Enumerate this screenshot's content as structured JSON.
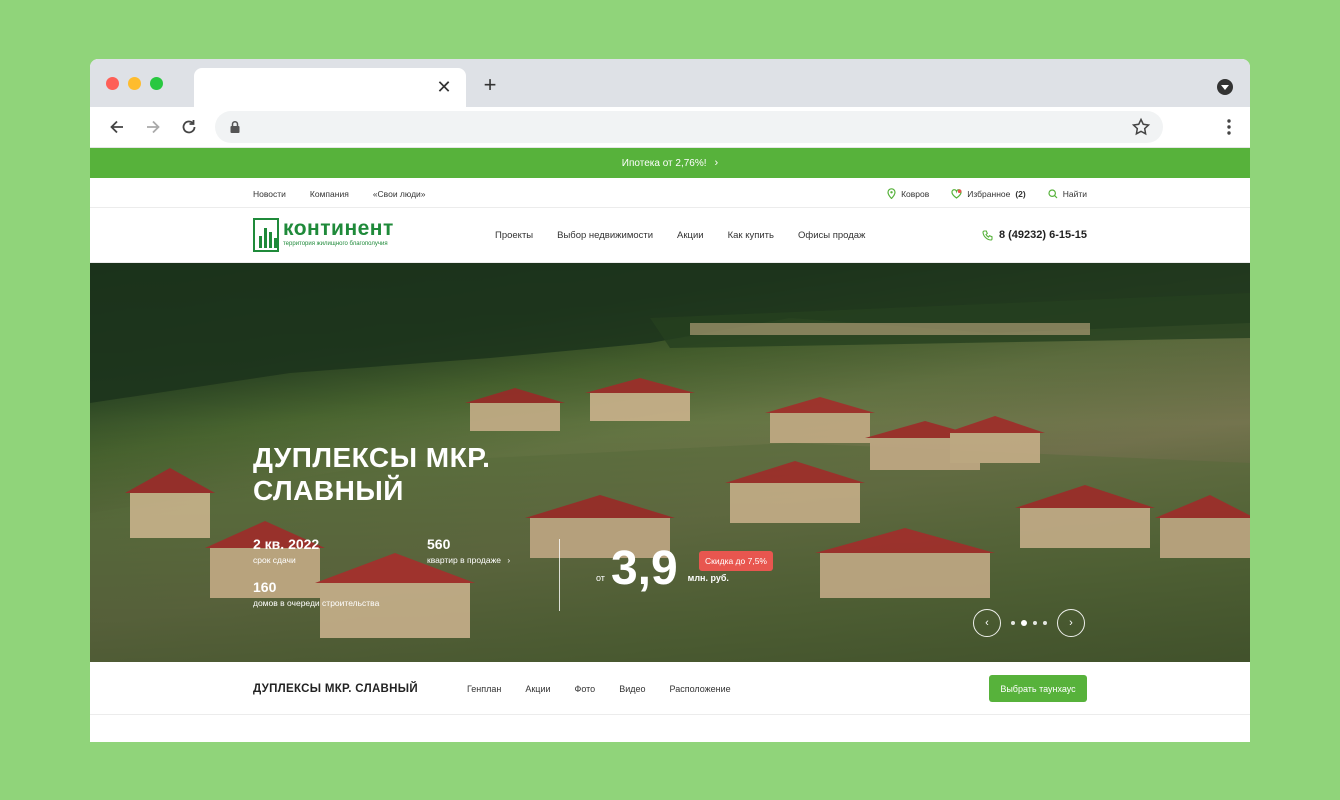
{
  "browser": {
    "tab_close": "✕",
    "new_tab": "+"
  },
  "promo": {
    "text": "Ипотека от 2,76%!",
    "arrow": "›"
  },
  "topnav": {
    "left": [
      "Новости",
      "Компания",
      "«Свои люди»"
    ],
    "city": "Ковров",
    "favorites_label": "Избранное",
    "favorites_count": "(2)",
    "search": "Найти"
  },
  "header": {
    "logo_name": "континент",
    "logo_tagline": "территория жилищного благополучия",
    "nav": [
      "Проекты",
      "Выбор недвижимости",
      "Акции",
      "Как купить",
      "Офисы продаж"
    ],
    "phone": "8 (49232) 6-15-15"
  },
  "hero": {
    "title_line1": "ДУПЛЕКСЫ МКР.",
    "title_line2": "СЛАВНЫЙ",
    "stats": [
      {
        "num": "2 кв. 2022",
        "label": "срок сдачи"
      },
      {
        "num": "560",
        "label": "квартир в продаже"
      },
      {
        "num": "160",
        "label": "домов в очереди строительства"
      }
    ],
    "stat_arrow": "›",
    "price_from": "от",
    "price": "3,9",
    "price_unit": "млн. руб.",
    "discount": "Скидка до 7,5%",
    "prev": "‹",
    "next": "›"
  },
  "subnav": {
    "title": "ДУПЛЕКСЫ МКР. СЛАВНЫЙ",
    "links": [
      "Генплан",
      "Акции",
      "Фото",
      "Видео",
      "Расположение"
    ],
    "cta": "Выбрать таунхаус"
  },
  "colors": {
    "brand_green": "#57b23b",
    "logo_green": "#1f8a3a",
    "discount_red": "#e8564f"
  }
}
